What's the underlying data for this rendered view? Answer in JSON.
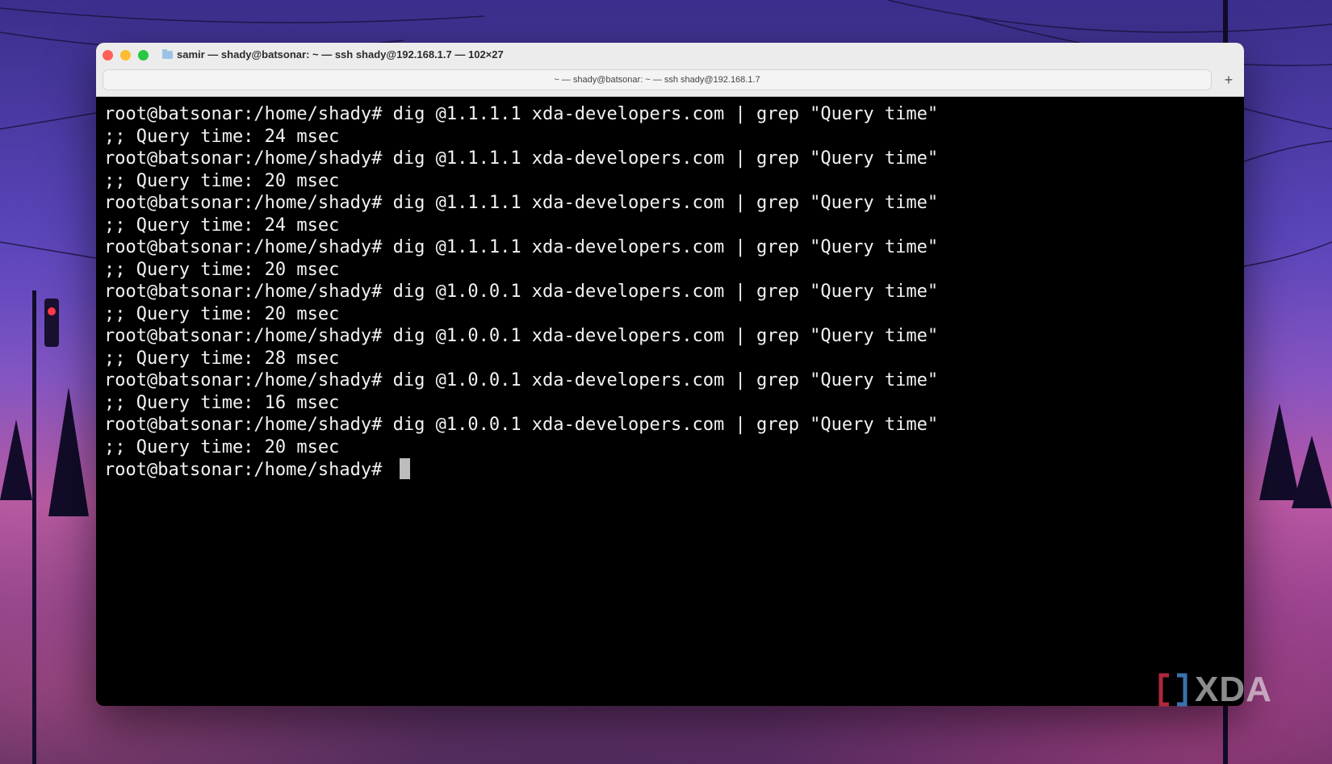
{
  "window": {
    "title": "samir — shady@batsonar: ~ — ssh shady@192.168.1.7 — 102×27",
    "icon": "folder-icon"
  },
  "tab": {
    "label": "~ — shady@batsonar: ~ — ssh shady@192.168.1.7",
    "new_tab_label": "+"
  },
  "terminal": {
    "lines": [
      "root@batsonar:/home/shady# dig @1.1.1.1 xda-developers.com | grep \"Query time\"",
      ";; Query time: 24 msec",
      "root@batsonar:/home/shady# dig @1.1.1.1 xda-developers.com | grep \"Query time\"",
      ";; Query time: 20 msec",
      "root@batsonar:/home/shady# dig @1.1.1.1 xda-developers.com | grep \"Query time\"",
      ";; Query time: 24 msec",
      "root@batsonar:/home/shady# dig @1.1.1.1 xda-developers.com | grep \"Query time\"",
      ";; Query time: 20 msec",
      "root@batsonar:/home/shady# dig @1.0.0.1 xda-developers.com | grep \"Query time\"",
      ";; Query time: 20 msec",
      "root@batsonar:/home/shady# dig @1.0.0.1 xda-developers.com | grep \"Query time\"",
      ";; Query time: 28 msec",
      "root@batsonar:/home/shady# dig @1.0.0.1 xda-developers.com | grep \"Query time\"",
      ";; Query time: 16 msec",
      "root@batsonar:/home/shady# dig @1.0.0.1 xda-developers.com | grep \"Query time\"",
      ";; Query time: 20 msec"
    ],
    "prompt": "root@batsonar:/home/shady# "
  },
  "watermark": {
    "text": "XDA"
  },
  "colors": {
    "close": "#ff5f57",
    "minimize": "#febc2e",
    "maximize": "#28c840",
    "terminal_bg": "#000000",
    "terminal_fg": "#f2f2f2"
  }
}
